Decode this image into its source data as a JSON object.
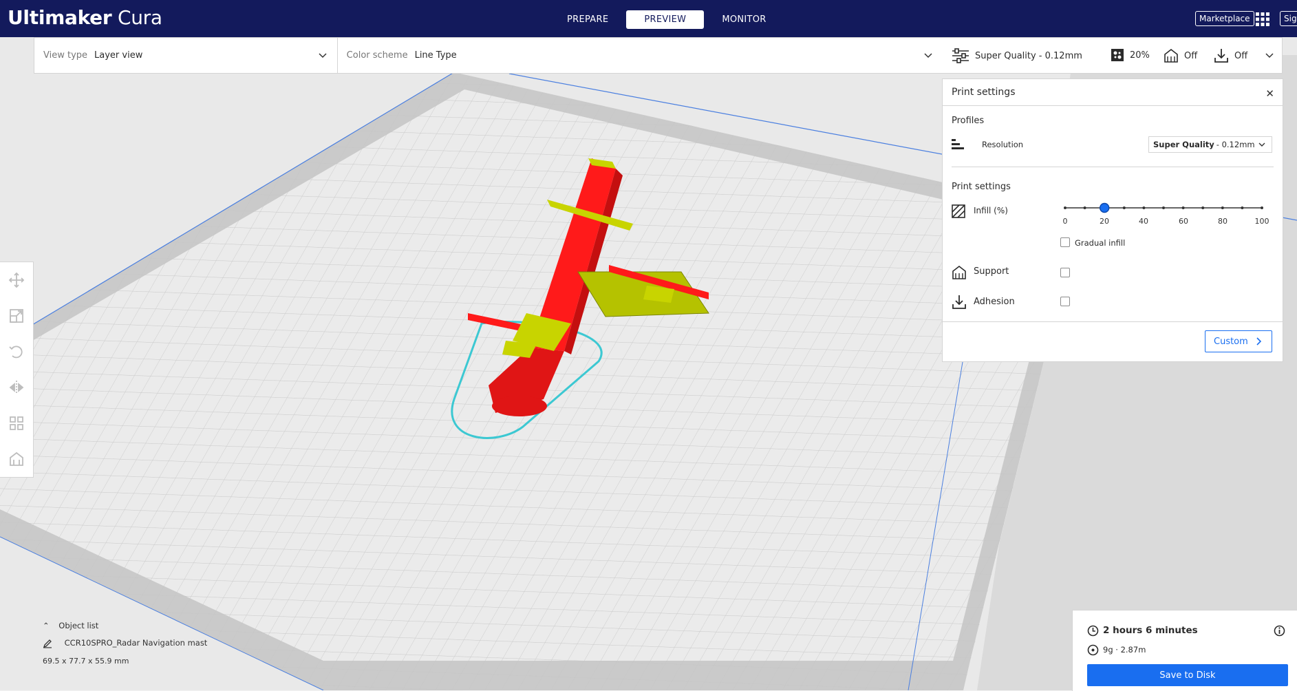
{
  "header": {
    "logo_bold": "Ultimaker",
    "logo_light": "Cura",
    "stages": [
      "PREPARE",
      "PREVIEW",
      "MONITOR"
    ],
    "active_stage": "PREVIEW",
    "marketplace_label": "Marketplace",
    "signin_label": "Sign in"
  },
  "viewbar": {
    "view_type_label": "View type",
    "view_type_value": "Layer view",
    "color_scheme_label": "Color scheme",
    "color_scheme_value": "Line Type"
  },
  "settingsbar": {
    "profile": "Super Quality - 0.12mm",
    "infill": "20%",
    "support": "Off",
    "adhesion": "Off"
  },
  "panel": {
    "title": "Print settings",
    "profiles_title": "Profiles",
    "resolution_label": "Resolution",
    "resolution_bold": "Super Quality",
    "resolution_rest": "- 0.12mm",
    "settings_title": "Print settings",
    "infill_label": "Infill (%)",
    "infill_value": 20,
    "infill_ticks": [
      "0",
      "20",
      "40",
      "60",
      "80",
      "100"
    ],
    "gradual_label": "Gradual infill",
    "support_label": "Support",
    "adhesion_label": "Adhesion",
    "custom_label": "Custom"
  },
  "objects": {
    "header": "Object list",
    "name": "CCR10SPRO_Radar Navigation mast",
    "dims": "69.5 x 77.7 x 55.9 mm"
  },
  "printinfo": {
    "time": "2 hours 6 minutes",
    "material": "9g · 2.87m",
    "save_label": "Save to Disk"
  },
  "colors": {
    "header_bg": "#131a5c",
    "accent": "#196ef0",
    "model_red": "#ff1a1a",
    "infill_yellow": "#c8d400",
    "skirt_cyan": "#3cc8d2"
  }
}
